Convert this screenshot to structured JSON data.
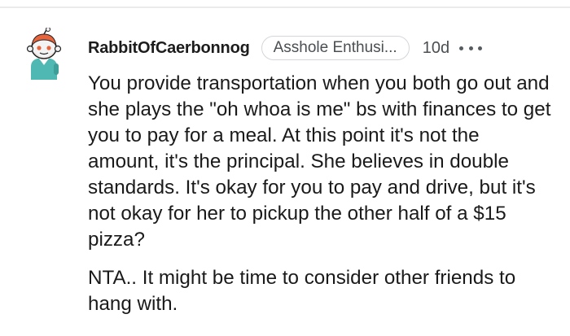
{
  "comment": {
    "username": "RabbitOfCaerbonnog",
    "flair": "Asshole Enthusi...",
    "age": "10d",
    "more_icon": "more-horizontal-icon",
    "avatar_icon": "snoo-avatar-icon",
    "paragraphs": [
      "You provide transportation when you both go out and she plays the \"oh whoa is me\" bs with finances to get you to pay for a meal. At this point it's not the amount, it's the principal. She believes in double standards. It's okay for you to pay and drive, but it's not okay for her to pickup the other half of a $15 pizza?",
      "NTA.. It might be time to consider other friends to hang with."
    ]
  },
  "colors": {
    "username": "#1c1c1c",
    "meta": "#4a4f52",
    "flair_border": "#d3d6da",
    "text": "#1a1a1b",
    "divider": "#e9ebed",
    "avatar_hair": "#e8643c",
    "avatar_shirt": "#4fb8b2"
  }
}
